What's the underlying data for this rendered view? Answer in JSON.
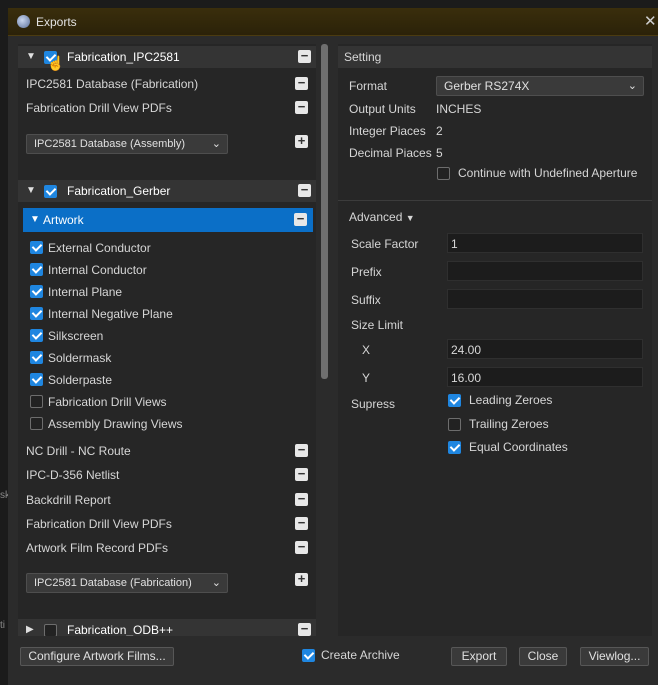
{
  "window": {
    "title": "Exports"
  },
  "left": {
    "group1": {
      "label": "Fabrication_IPC2581"
    },
    "group1_items": [
      "IPC2581 Database (Fabrication)",
      "Fabrication Drill View PDFs"
    ],
    "dropdown1": "IPC2581 Database (Assembly)",
    "group2": {
      "label": "Fabrication_Gerber"
    },
    "artwork": {
      "label": "Artwork"
    },
    "layers": [
      {
        "label": "External Conductor",
        "checked": true
      },
      {
        "label": "Internal Conductor",
        "checked": true
      },
      {
        "label": "Internal Plane",
        "checked": true
      },
      {
        "label": "Internal Negative Plane",
        "checked": true
      },
      {
        "label": "Silkscreen",
        "checked": true
      },
      {
        "label": "Soldermask",
        "checked": true
      },
      {
        "label": "Solderpaste",
        "checked": true
      },
      {
        "label": "Fabrication Drill Views",
        "checked": false
      },
      {
        "label": "Assembly Drawing Views",
        "checked": false
      }
    ],
    "group2_items": [
      "NC Drill - NC Route",
      "IPC-D-356 Netlist",
      "Backdrill Report",
      "Fabrication Drill View PDFs",
      "Artwork Film Record PDFs"
    ],
    "dropdown2": "IPC2581 Database (Fabrication)",
    "group3": {
      "label": "Fabrication_ODB++"
    }
  },
  "right": {
    "header": "Setting",
    "format": {
      "label": "Format",
      "value": "Gerber RS274X"
    },
    "output_units": {
      "label": "Output Units",
      "value": "INCHES"
    },
    "integer_places": {
      "label": "Integer Piaces",
      "value": "2"
    },
    "decimal_places": {
      "label": "Decimal Piaces",
      "value": "5"
    },
    "undefined_aperture": {
      "label": "Continue with Undefined Aperture",
      "checked": false
    },
    "advanced": "Advanced",
    "scale_factor": {
      "label": "Scale Factor",
      "value": "1"
    },
    "prefix": {
      "label": "Prefix",
      "value": ""
    },
    "suffix": {
      "label": "Suffix",
      "value": ""
    },
    "size_limit": {
      "label": "Size Limit",
      "x_label": "X",
      "x_value": "24.00",
      "y_label": "Y",
      "y_value": "16.00"
    },
    "supress": {
      "label": "Supress"
    },
    "leading_zeroes": {
      "label": "Leading Zeroes",
      "checked": true
    },
    "trailing_zeroes": {
      "label": "Trailing Zeroes",
      "checked": false
    },
    "equal_coordinates": {
      "label": "Equal Coordinates",
      "checked": true
    }
  },
  "footer": {
    "configure": "Configure Artwork Films...",
    "create_archive": "Create Archive",
    "export": "Export",
    "close": "Close",
    "viewlog": "Viewlog..."
  },
  "edge_fragments": {
    "a": "sk",
    "b": "ti"
  }
}
